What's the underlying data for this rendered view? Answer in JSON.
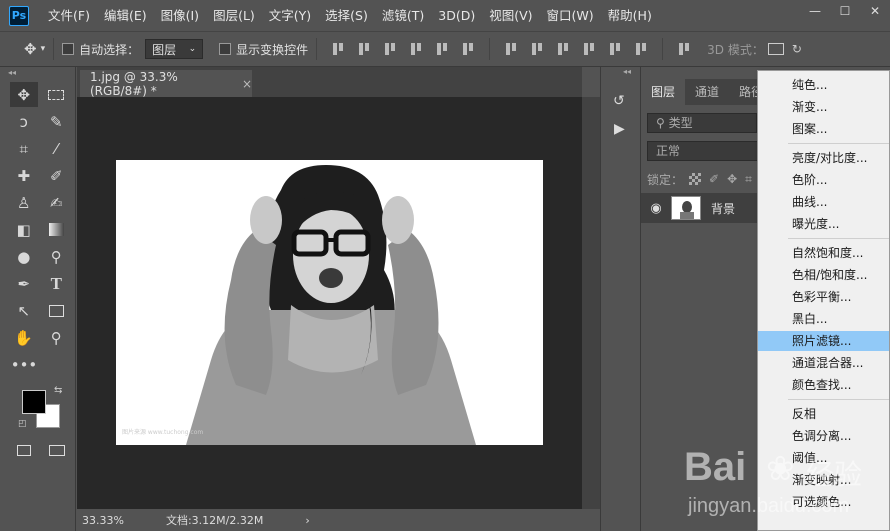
{
  "app": {
    "logo": "Ps"
  },
  "menubar": {
    "items": [
      "文件(F)",
      "编辑(E)",
      "图像(I)",
      "图层(L)",
      "文字(Y)",
      "选择(S)",
      "滤镜(T)",
      "3D(D)",
      "视图(V)",
      "窗口(W)",
      "帮助(H)"
    ]
  },
  "window_controls": {
    "minimize": "—",
    "maximize": "☐",
    "close": "✕"
  },
  "options": {
    "auto_select_label": "自动选择：",
    "auto_select_value": "图层",
    "show_transform_label": "显示变换控件",
    "mode_label": "3D 模式："
  },
  "document": {
    "tab_title": "1.jpg @ 33.3%(RGB/8#) *",
    "tab_close": "×",
    "zoom": "33.33%",
    "doc_size": "文档:3.12M/2.32M",
    "status_arrow": "›",
    "image_watermark": "图片来源 www.tuchong.com"
  },
  "layers_panel": {
    "tabs": [
      "图层",
      "通道",
      "路径"
    ],
    "filter_placeholder": "类型",
    "blend_mode": "正常",
    "lock_label": "锁定：",
    "layer_name": "背景"
  },
  "adjustment_menu": {
    "groups": [
      [
        "纯色...",
        "渐变...",
        "图案..."
      ],
      [
        "亮度/对比度...",
        "色阶...",
        "曲线...",
        "曝光度..."
      ],
      [
        "自然饱和度...",
        "色相/饱和度...",
        "色彩平衡...",
        "黑白...",
        "照片滤镜...",
        "通道混合器...",
        "颜色查找..."
      ],
      [
        "反相",
        "色调分离...",
        "阈值...",
        "渐变映射...",
        "可选颜色..."
      ]
    ],
    "highlighted": "照片滤镜..."
  },
  "watermark": {
    "brand": "Bai",
    "brand2": "经验",
    "url": "jingyan.baidu.com"
  },
  "colors": {
    "foreground": "#000000",
    "background": "#ffffff",
    "highlight": "#91c9f7"
  }
}
